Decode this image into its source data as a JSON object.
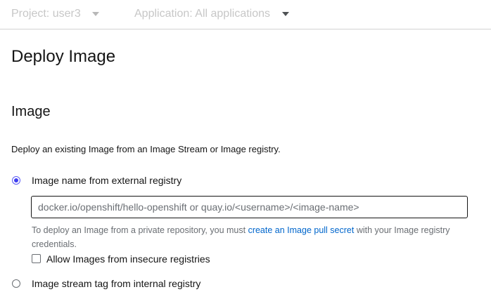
{
  "topbar": {
    "project_label": "Project: user3",
    "application_label": "Application: All applications"
  },
  "page": {
    "title": "Deploy Image"
  },
  "image_section": {
    "title": "Image",
    "description": "Deploy an existing Image from an Image Stream or Image registry.",
    "option_external": {
      "label": "Image name from external registry",
      "selected": true
    },
    "image_name_input": {
      "value": "",
      "placeholder": "docker.io/openshift/hello-openshift or quay.io/<username>/<image-name>"
    },
    "helper": {
      "before_link": "To deploy an Image from a private repository, you must ",
      "link_text": "create an Image pull secret",
      "after_link": " with your Image registry credentials."
    },
    "allow_insecure": {
      "label": "Allow Images from insecure registries",
      "checked": false
    },
    "option_internal": {
      "label": "Image stream tag from internal registry",
      "selected": false
    }
  },
  "colors": {
    "link": "#0066cc",
    "radio_selected": "#3e3ef0",
    "border": "#d2d2d2"
  }
}
